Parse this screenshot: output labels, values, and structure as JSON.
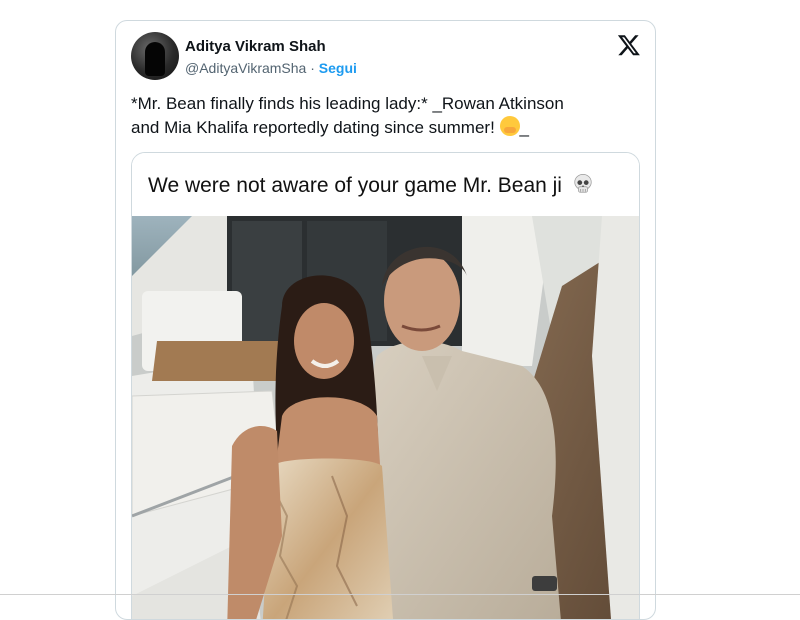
{
  "tweet": {
    "author_name": "Aditya Vikram Shah",
    "author_handle": "@AdityaVikramSha",
    "separator": "·",
    "follow_label": "Segui",
    "text_line1": "*Mr. Bean finally finds his leading lady:* _Rowan Atkinson",
    "text_line2": "and Mia Khalifa reportedly dating since summer!",
    "text_tail": "_"
  },
  "media": {
    "caption": "We were not aware of your game Mr. Bean ji"
  },
  "icons": {
    "platform": "x-logo-icon",
    "caption_emoji": "skull-icon",
    "text_emoji": "hugging-face-icon"
  },
  "colors": {
    "link": "#1d9bf0",
    "secondary_text": "#536471",
    "border": "#cfd9de"
  }
}
